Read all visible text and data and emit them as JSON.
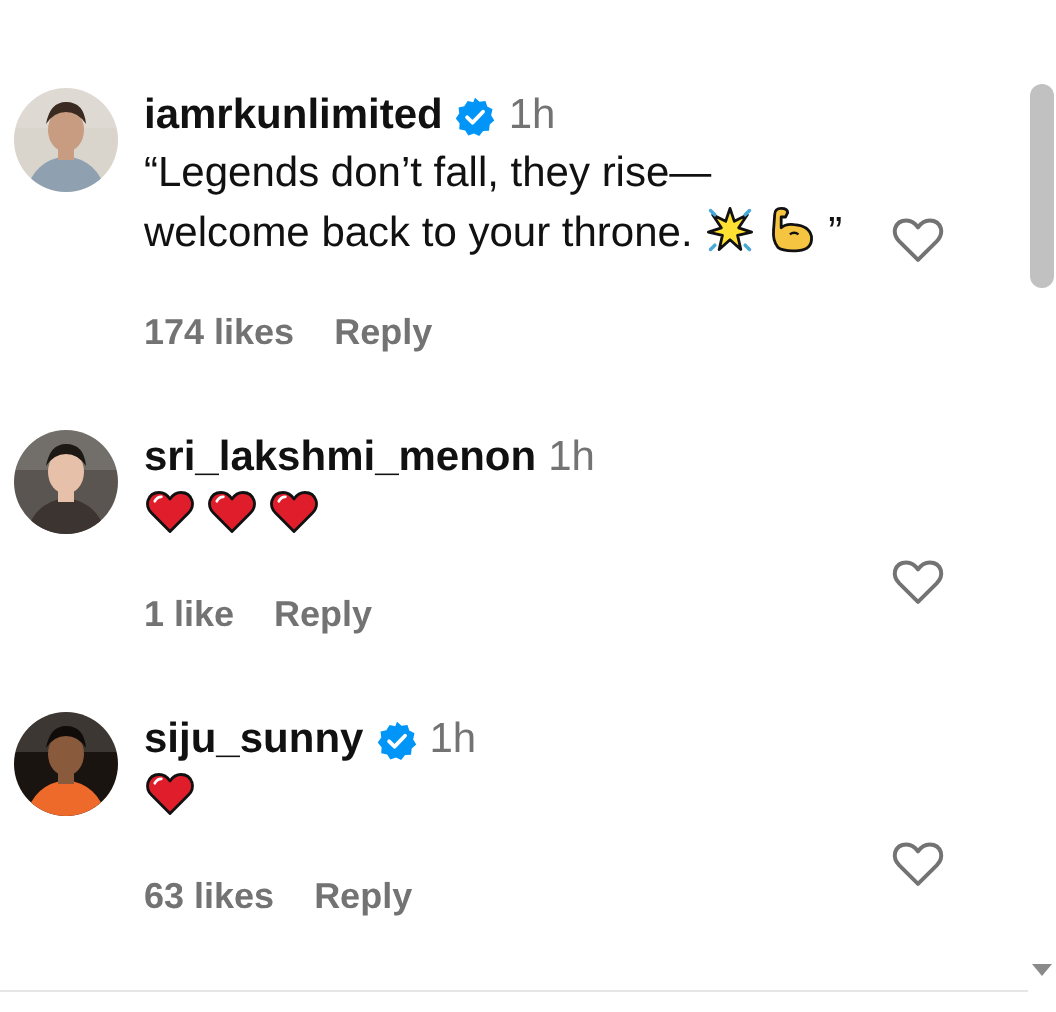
{
  "comments": [
    {
      "username": "iamrkunlimited",
      "verified": true,
      "time": "1h",
      "body": [
        {
          "kind": "text",
          "text": "“Legends don’t fall, they rise—welcome back to your throne. "
        },
        {
          "kind": "sparkle"
        },
        {
          "kind": "flexed-biceps"
        },
        {
          "kind": "text",
          "text": "”"
        }
      ],
      "likes": "174 likes",
      "reply": "Reply"
    },
    {
      "username": "sri_lakshmi_menon",
      "verified": false,
      "time": "1h",
      "body": [
        {
          "kind": "heart"
        },
        {
          "kind": "heart"
        },
        {
          "kind": "heart"
        }
      ],
      "likes": "1 like",
      "reply": "Reply"
    },
    {
      "username": "siju_sunny",
      "verified": true,
      "time": "1h",
      "body": [
        {
          "kind": "heart"
        }
      ],
      "likes": "63 likes",
      "reply": "Reply"
    }
  ]
}
